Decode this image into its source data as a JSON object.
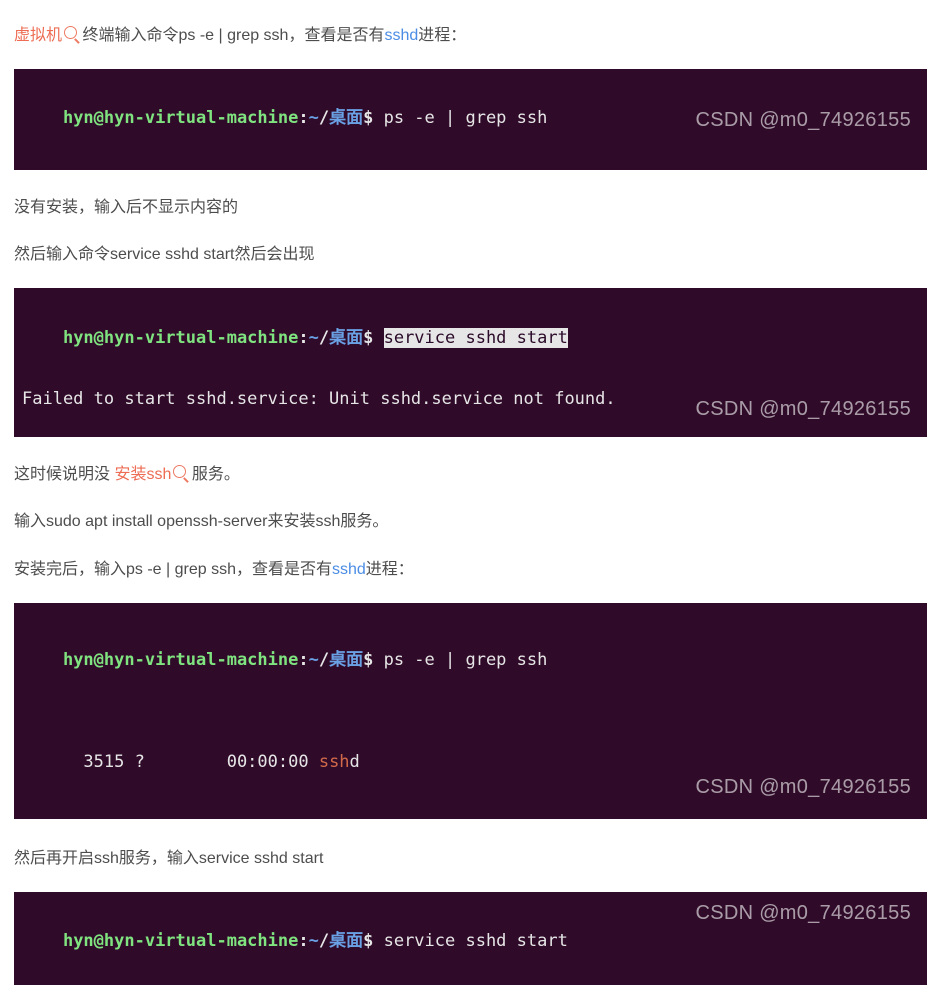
{
  "watermark": "CSDN @m0_74926155",
  "prompt": {
    "user": "hyn@hyn-virtual-machine",
    "sep1": ":",
    "path1": "~",
    "sep2": "/",
    "path2": "桌面",
    "dollar": "$ "
  },
  "p1": {
    "a": "虚拟机",
    "b": "终端输入命令ps -e | grep ssh，查看是否有",
    "c": "sshd",
    "d": "进程："
  },
  "t1_cmd": "ps -e | grep ssh",
  "p2": "没有安装，输入后不显示内容的",
  "p3": "然后输入命令service sshd start然后会出现",
  "t2_cmd": "service sshd start",
  "t2_err": "Failed to start sshd.service: Unit sshd.service not found.",
  "p4": {
    "a": "这时候说明没 ",
    "b": "安装ssh",
    "c": "服务。"
  },
  "p5": "输入sudo apt install openssh-server来安装ssh服务。",
  "p6": {
    "a": "安装完后，输入ps -e | grep ssh，查看是否有",
    "b": "sshd",
    "c": "进程："
  },
  "t3_cmd": "ps -e | grep ssh",
  "t3_out_a": "  3515 ?        00:00:00 ",
  "t3_out_b": "ssh",
  "t3_out_c": "d",
  "p7": "然后再开启ssh服务，输入service sshd start",
  "t4_cmd": "service sshd start"
}
